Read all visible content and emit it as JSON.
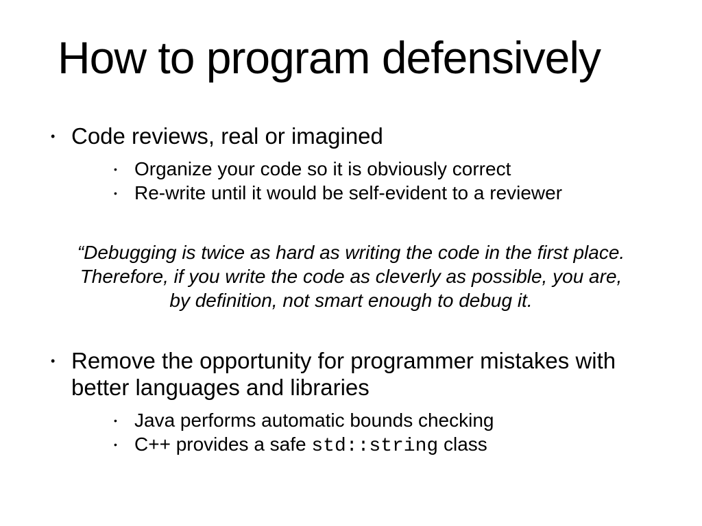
{
  "title": "How to program defensively",
  "bullets1": {
    "main": "Code reviews, real or imagined",
    "sub": [
      "Organize your code so it is obviously correct",
      "Re-write until it would be self-evident to a reviewer"
    ]
  },
  "quote": {
    "line1": "“Debugging is twice as hard as writing the code in the first place.",
    "line2": "Therefore, if you write the code as cleverly as possible, you are,",
    "line3": "by definition, not smart enough to debug it."
  },
  "bullets2": {
    "main": "Remove the opportunity for programmer mistakes with better languages and libraries",
    "sub1": "Java performs automatic bounds checking",
    "sub2_prefix": "C++ provides a safe ",
    "sub2_code": "std::string",
    "sub2_suffix": " class"
  }
}
